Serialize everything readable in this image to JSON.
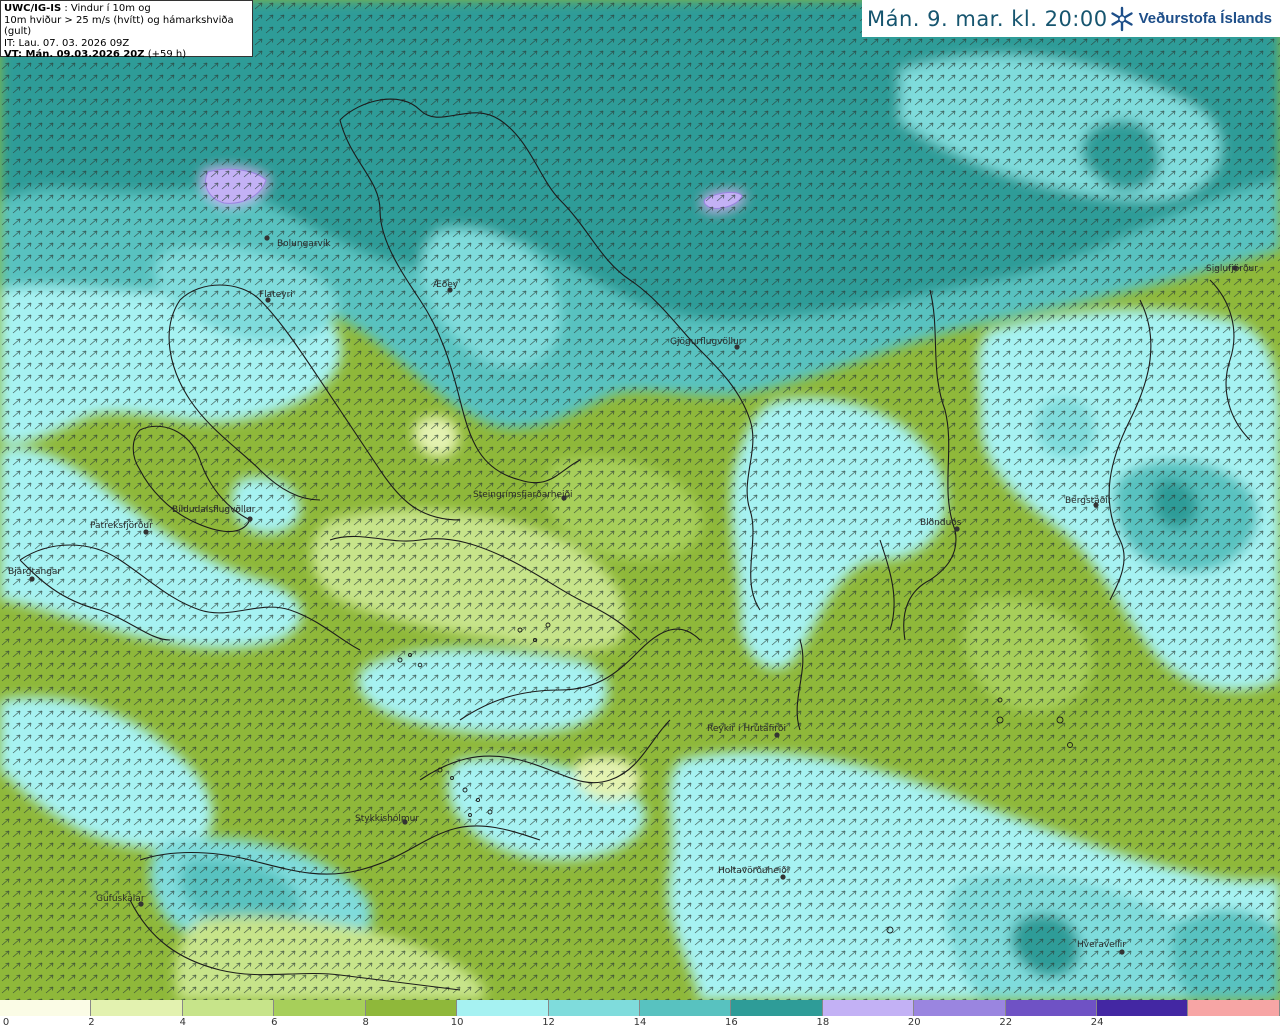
{
  "info": {
    "model_code": "UWC/IG-IS",
    "line1_rest": " : Vindur í 10m og",
    "line2": "10m hviður > 25 m/s (hvítt) og hámarkshviða (gult)",
    "line3": "IT: Lau. 07. 03. 2026 09Z",
    "line4_bold": "VT: Mán. 09.03.2026 20Z",
    "line4_rest": " (+59 h)"
  },
  "header": {
    "valid_time": "Mán. 9. mar. kl. 20:00",
    "logo_text": "Veðurstofa Íslands",
    "logo_icon": "snowflake-icon"
  },
  "towns": [
    {
      "id": "bolungarvik",
      "label": "Bolungarvík"
    },
    {
      "id": "flateyri",
      "label": "Flateyri"
    },
    {
      "id": "aedey",
      "label": "Æðey"
    },
    {
      "id": "gjogurflugvollur",
      "label": "Gjögurflugvöllur"
    },
    {
      "id": "siglufjordur",
      "label": "Siglufjörður"
    },
    {
      "id": "steingrimsfjardarheidi",
      "label": "Steingrímsfjarðarheiði"
    },
    {
      "id": "bildudalsflugvollur",
      "label": "Bíldudalsflugvöllur"
    },
    {
      "id": "patreksfjordur",
      "label": "Patreksfjörður"
    },
    {
      "id": "bjargtangar",
      "label": "Bjargtangar"
    },
    {
      "id": "blonduos",
      "label": "Blönduós"
    },
    {
      "id": "bergstadir",
      "label": "Bergstaðir"
    },
    {
      "id": "reykir",
      "label": "Reykir í Hrútafirði"
    },
    {
      "id": "stykkisholmur",
      "label": "Stykkishólmur"
    },
    {
      "id": "holtavorduheidi",
      "label": "Holtavörðuheiði"
    },
    {
      "id": "gufuskalar",
      "label": "Gufuskálar"
    },
    {
      "id": "hveravellir",
      "label": "Hveravellir"
    }
  ],
  "colorbar": {
    "unit": "m/s",
    "colors": [
      "#fbfce6",
      "#e3f2b0",
      "#c7e48a",
      "#a7cf5a",
      "#8fb83a",
      "#a6f2f2",
      "#7fdcdc",
      "#58c2c0",
      "#2e9c98",
      "#c3b1f5",
      "#9a85e0",
      "#6f52c5",
      "#4327a3",
      "#f7a5a5"
    ],
    "labels": [
      "0",
      "2",
      "4",
      "6",
      "8",
      "10",
      "12",
      "14",
      "16",
      "18",
      "20",
      "22",
      "24"
    ]
  }
}
